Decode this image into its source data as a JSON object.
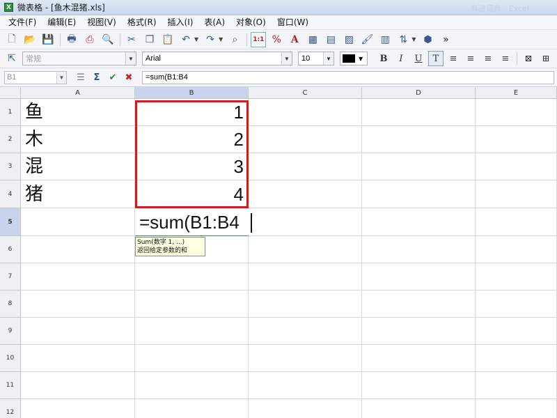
{
  "window": {
    "title": "微表格 - [鱼木混猪.xls]",
    "app_icon": "X",
    "ghost_title": "有道词典 - Excel"
  },
  "menu": [
    "文件(F)",
    "编辑(E)",
    "视图(V)",
    "格式(R)",
    "插入(I)",
    "表(A)",
    "对象(O)",
    "窗口(W)"
  ],
  "toolbar": {
    "more": "»",
    "style_value": "常规",
    "font_value": "Arial",
    "size_value": "10",
    "bold": "B",
    "italic": "I",
    "underline": "U",
    "text_color": "#000000"
  },
  "formula_bar": {
    "name_box": "B1",
    "formula": "=sum(B1:B4"
  },
  "grid": {
    "columns": [
      "A",
      "B",
      "C",
      "D",
      "E"
    ],
    "rows": [
      "1",
      "2",
      "3",
      "4",
      "5",
      "6",
      "7",
      "8",
      "9",
      "10",
      "11",
      "12"
    ],
    "cells": {
      "A1": "鱼",
      "A2": "木",
      "A3": "混",
      "A4": "猪",
      "B1": "1",
      "B2": "2",
      "B3": "3",
      "B4": "4"
    },
    "editing_text": "=sum(B1:B4",
    "range_color": "#e0141e"
  },
  "tooltip": {
    "line1": "Sum(数字 1, ...)",
    "line2": "返回给定参数的和"
  }
}
